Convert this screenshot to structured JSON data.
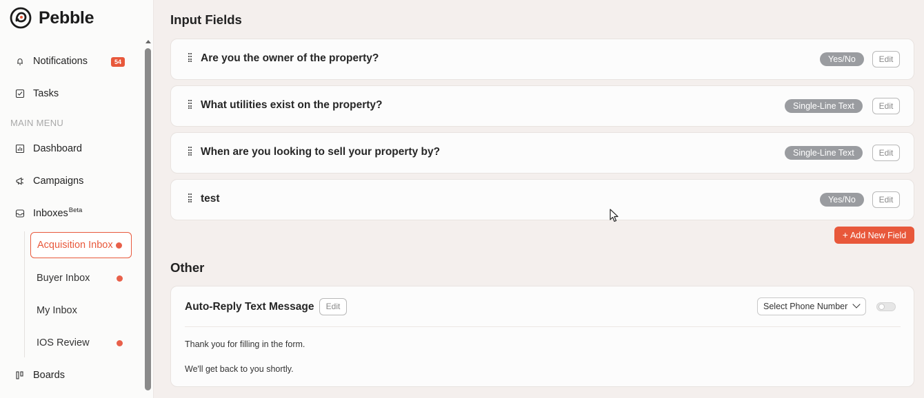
{
  "brand": {
    "name": "Pebble",
    "accent": "#e8583b"
  },
  "sidebar": {
    "notifications": {
      "label": "Notifications",
      "badge": "54",
      "icon": "bell-icon"
    },
    "tasks": {
      "label": "Tasks",
      "icon": "checkbox-icon"
    },
    "section_label": "MAIN MENU",
    "dashboard": {
      "label": "Dashboard",
      "icon": "chart-icon"
    },
    "campaigns": {
      "label": "Campaigns",
      "icon": "megaphone-icon"
    },
    "inboxes": {
      "label": "Inboxes",
      "sup": "Beta",
      "icon": "inbox-icon"
    },
    "sub_items": [
      {
        "label": "Acquisition Inbox",
        "active": true,
        "dot": true
      },
      {
        "label": "Buyer Inbox",
        "active": false,
        "dot": true
      },
      {
        "label": "My Inbox",
        "active": false,
        "dot": false
      },
      {
        "label": "IOS Review",
        "active": false,
        "dot": true
      }
    ],
    "boards": {
      "label": "Boards",
      "icon": "kanban-icon"
    }
  },
  "input_fields": {
    "title": "Input Fields",
    "fields": [
      {
        "label": "Are you the owner of the property?",
        "type": "Yes/No",
        "edit": "Edit"
      },
      {
        "label": "What utilities exist on the property?",
        "type": "Single-Line Text",
        "edit": "Edit"
      },
      {
        "label": "When are you looking to sell your property by?",
        "type": "Single-Line Text",
        "edit": "Edit"
      },
      {
        "label": "test",
        "type": "Yes/No",
        "edit": "Edit"
      }
    ],
    "add_button": "Add New Field"
  },
  "other": {
    "title": "Other",
    "auto_reply": {
      "title": "Auto-Reply Text Message",
      "edit": "Edit",
      "select_label": "Select Phone Number",
      "toggle_on": false,
      "message_line1": "Thank you for filling in the form.",
      "message_line2": "We'll get back to you shortly."
    }
  }
}
